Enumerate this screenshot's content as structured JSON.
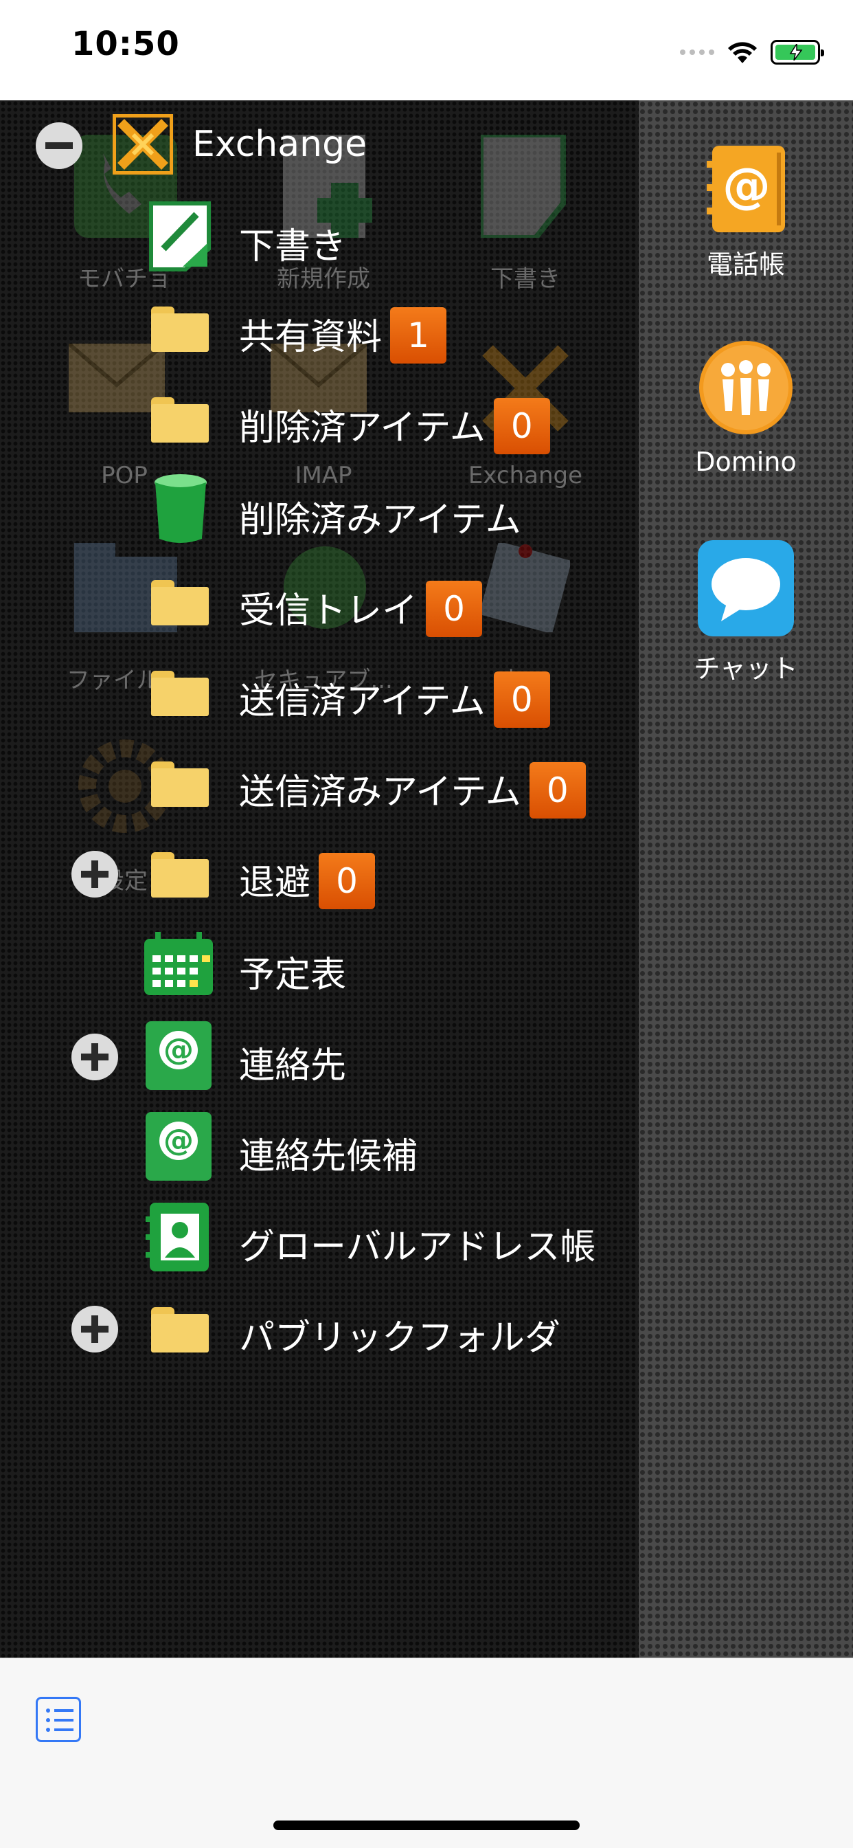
{
  "status_bar": {
    "time": "10:50"
  },
  "background_grid": [
    {
      "label": "モバチョ"
    },
    {
      "label": "新規作成"
    },
    {
      "label": "下書き"
    },
    {
      "label": "POP"
    },
    {
      "label": "IMAP"
    },
    {
      "label": "Exchange"
    },
    {
      "label": "ファイル..."
    },
    {
      "label": "セキュアブ..."
    },
    {
      "label": "お..."
    },
    {
      "label": "設定"
    }
  ],
  "tree": {
    "root": {
      "label": "Exchange",
      "icon": "exchange-icon",
      "expanded": true
    },
    "items": [
      {
        "label": "下書き",
        "icon": "draft-icon"
      },
      {
        "label": "共有資料",
        "icon": "folder-icon",
        "badge": "1"
      },
      {
        "label": "削除済アイテム",
        "icon": "folder-icon",
        "badge": "0"
      },
      {
        "label": "削除済みアイテム",
        "icon": "trash-icon"
      },
      {
        "label": "受信トレイ",
        "icon": "folder-icon",
        "badge": "0"
      },
      {
        "label": "送信済アイテム",
        "icon": "folder-icon",
        "badge": "0"
      },
      {
        "label": "送信済みアイテム",
        "icon": "folder-icon",
        "badge": "0"
      },
      {
        "label": "退避",
        "icon": "folder-icon",
        "badge": "0",
        "expandable": true
      },
      {
        "label": "予定表",
        "icon": "calendar-icon"
      },
      {
        "label": "連絡先",
        "icon": "contacts-icon",
        "expandable": true
      },
      {
        "label": "連絡先候補",
        "icon": "contacts-icon"
      },
      {
        "label": "グローバルアドレス帳",
        "icon": "address-book-icon"
      },
      {
        "label": "パブリックフォルダ",
        "icon": "folder-icon",
        "expandable": true
      }
    ]
  },
  "right_panel": {
    "apps": [
      {
        "label": "電話帳",
        "icon": "phonebook-icon",
        "color": "#f5a623"
      },
      {
        "label": "Domino",
        "icon": "domino-icon",
        "color": "#f39a1e"
      },
      {
        "label": "チャット",
        "icon": "chat-icon",
        "color": "#29a9e8"
      }
    ]
  },
  "toolbar": {
    "icon": "list-icon"
  },
  "colors": {
    "badge": "#e8630d",
    "folder": "#f6d26a",
    "green": "#2aa84a",
    "accent": "#3478f6"
  }
}
